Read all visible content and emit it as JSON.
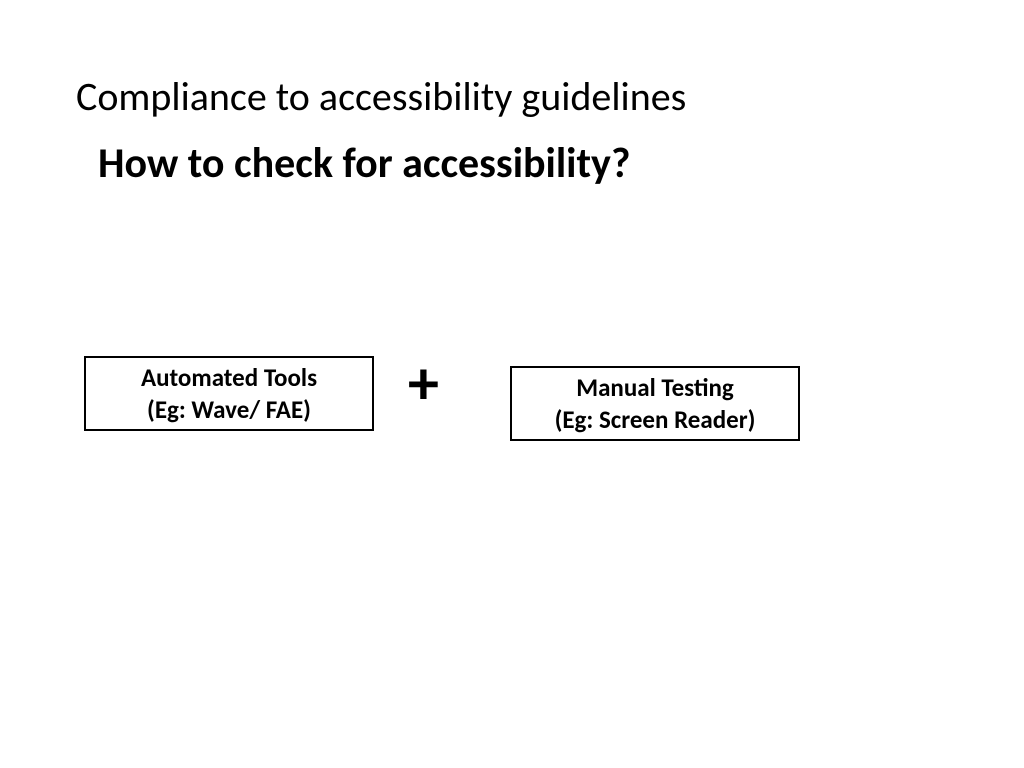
{
  "title": "Compliance to accessibility guidelines",
  "subtitle": "How to check for accessibility?",
  "boxes": {
    "left": {
      "line1": "Automated Tools",
      "line2": "(Eg: Wave/ FAE)"
    },
    "right": {
      "line1": "Manual Testing",
      "line2": "(Eg: Screen Reader)"
    }
  },
  "operator": "+"
}
